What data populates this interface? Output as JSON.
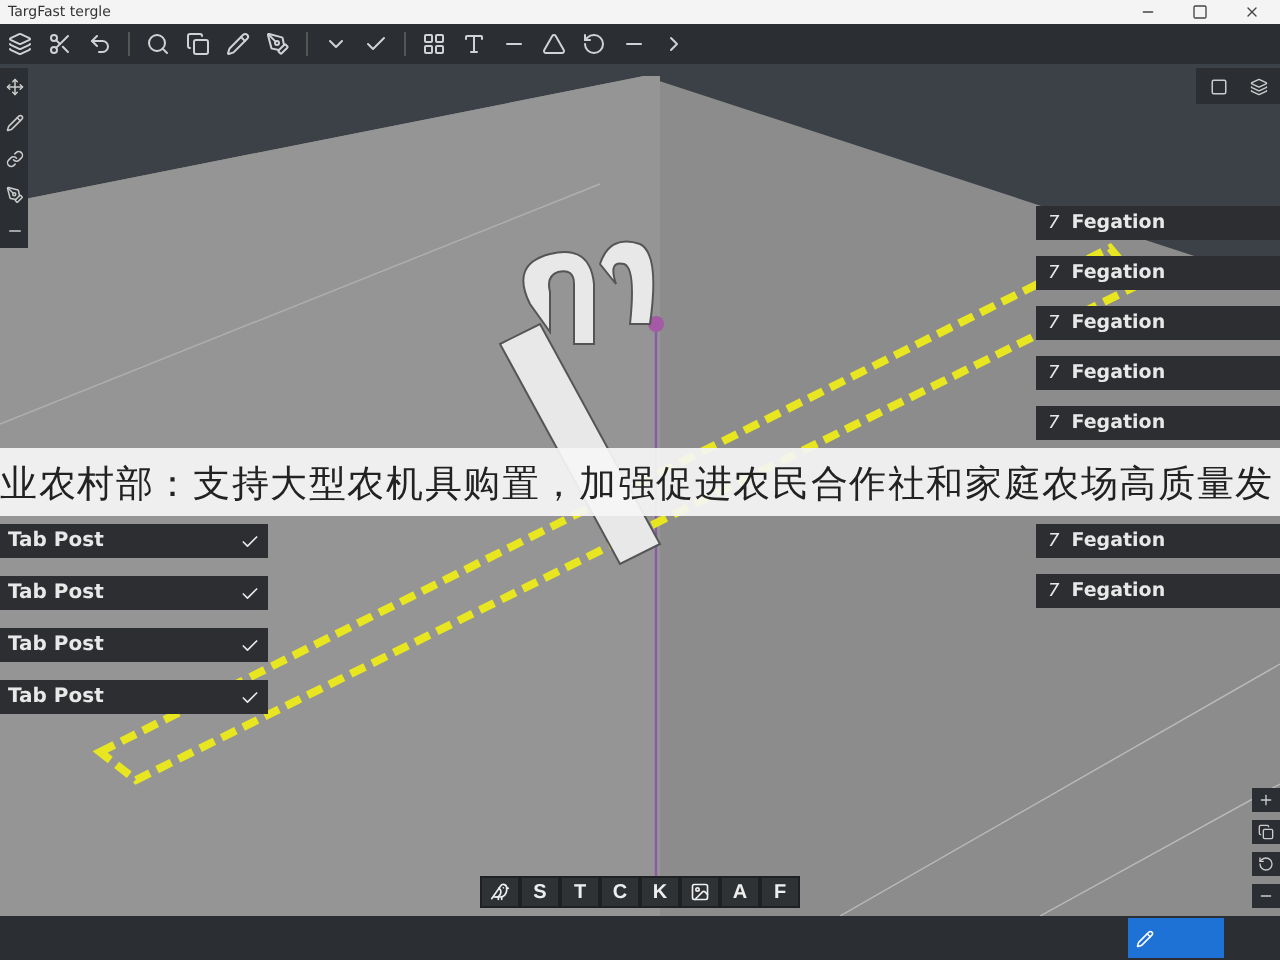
{
  "window": {
    "title": "TargFast tergle"
  },
  "headline": "业农村部：支持大型农机具购置，加强促进农民合作社和家庭农场高质量发",
  "left_panel": [
    {
      "label": "Tab Post",
      "checked": true
    },
    {
      "label": "Tab Post",
      "checked": true
    },
    {
      "label": "Tab Post",
      "checked": true
    },
    {
      "label": "Tab Post",
      "checked": true
    }
  ],
  "right_panel": [
    {
      "number": "7",
      "label": "Fegation"
    },
    {
      "number": "7",
      "label": "Fegation"
    },
    {
      "number": "7",
      "label": "Fegation"
    },
    {
      "number": "7",
      "label": "Fegation"
    },
    {
      "number": "7",
      "label": "Fegation"
    },
    {
      "number": "7",
      "label": "Fegation"
    },
    {
      "number": "7",
      "label": "Fegation"
    }
  ],
  "bottom_toolbar": [
    {
      "kind": "icon"
    },
    {
      "kind": "letter",
      "label": "S"
    },
    {
      "kind": "letter",
      "label": "T"
    },
    {
      "kind": "letter",
      "label": "C"
    },
    {
      "kind": "letter",
      "label": "K"
    },
    {
      "kind": "icon"
    },
    {
      "kind": "letter",
      "label": "A"
    },
    {
      "kind": "letter",
      "label": "F"
    }
  ]
}
